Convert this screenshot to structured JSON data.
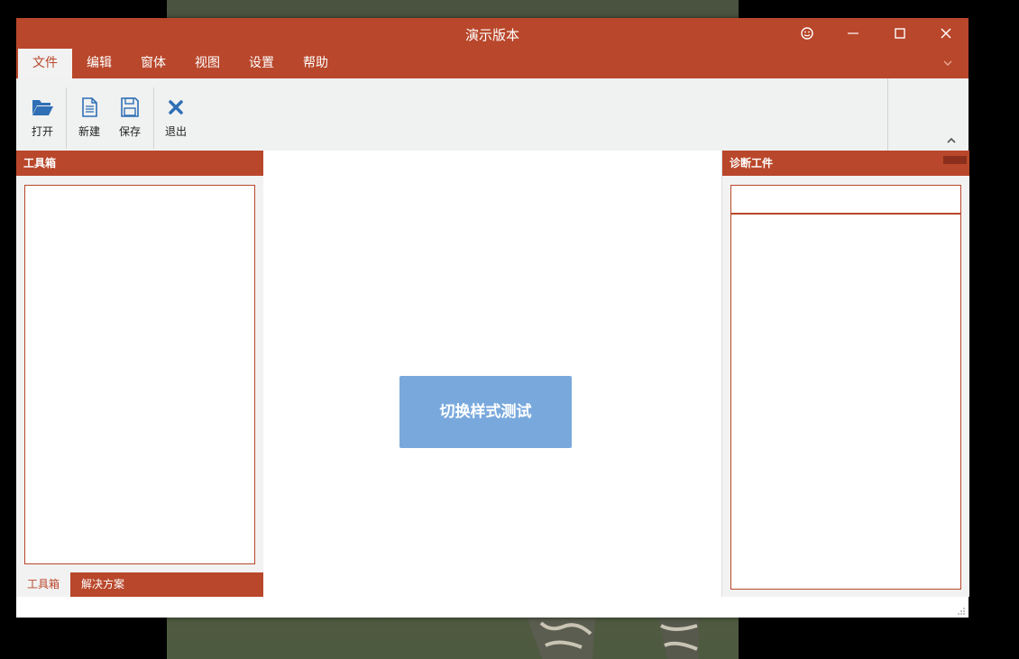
{
  "window": {
    "title": "演示版本"
  },
  "menu": [
    "文件",
    "编辑",
    "窗体",
    "视图",
    "设置",
    "帮助"
  ],
  "ribbon": {
    "open": "打开",
    "new": "新建",
    "save": "保存",
    "exit": "退出"
  },
  "left_panel": {
    "title": "工具箱",
    "tabs": [
      "工具箱",
      "解决方案"
    ]
  },
  "center": {
    "button_label": "切换样式测试"
  },
  "right_panel": {
    "title": "诊断工件"
  },
  "colors": {
    "accent": "#b9472b",
    "button": "#79a9dc"
  }
}
